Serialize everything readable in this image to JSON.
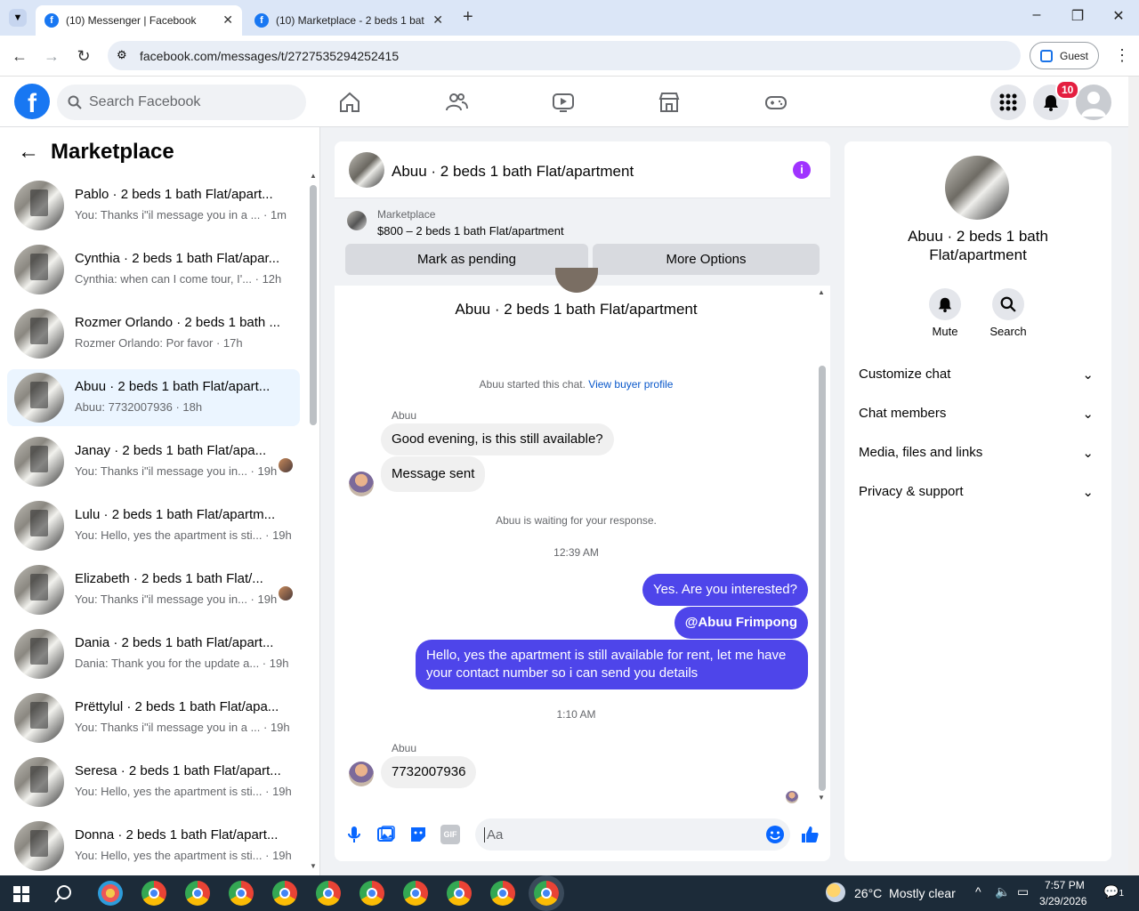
{
  "browser": {
    "tabs": [
      {
        "title": "(10) Messenger | Facebook",
        "active": true
      },
      {
        "title": "(10) Marketplace - 2 beds 1 bat",
        "active": false
      }
    ],
    "url": "facebook.com/messages/t/2727535294252415",
    "guest_label": "Guest"
  },
  "fb": {
    "search_placeholder": "Search Facebook",
    "notifications_count": "10"
  },
  "left": {
    "title": "Marketplace",
    "conversations": [
      {
        "title": "Pablo · 2 beds 1 bath Flat/apart...",
        "snippet": "You: Thanks i\"il message you in a ... · 1m"
      },
      {
        "title": "Cynthia · 2 beds 1 bath Flat/apar...",
        "snippet": "Cynthia: when can I come tour, I'... · 12h"
      },
      {
        "title": "Rozmer Orlando · 2 beds 1 bath ...",
        "snippet": "Rozmer Orlando: Por favor · 17h"
      },
      {
        "title": "Abuu · 2 beds 1 bath Flat/apart...",
        "snippet": "Abuu: 7732007936 · 18h",
        "selected": true
      },
      {
        "title": "Janay · 2 beds 1 bath Flat/apa...",
        "snippet": "You: Thanks i\"il message you in... · 19h",
        "read_receipt": true
      },
      {
        "title": "Lulu · 2 beds 1 bath Flat/apartm...",
        "snippet": "You: Hello, yes the apartment is sti... · 19h"
      },
      {
        "title": "Elizabeth · 2 beds 1 bath Flat/...",
        "snippet": "You: Thanks i\"il message you in... · 19h",
        "read_receipt": true
      },
      {
        "title": "Dania · 2 beds 1 bath Flat/apart...",
        "snippet": "Dania: Thank you for the update a... · 19h"
      },
      {
        "title": "Prëttylul · 2 beds 1 bath Flat/apa...",
        "snippet": "You: Thanks i\"il message you in a ... · 19h"
      },
      {
        "title": "Seresa · 2 beds 1 bath Flat/apart...",
        "snippet": "You: Hello, yes the apartment is sti... · 19h"
      },
      {
        "title": "Donna · 2 beds 1 bath Flat/apart...",
        "snippet": "You: Hello, yes the apartment is sti... · 19h"
      }
    ]
  },
  "chat": {
    "title": "Abuu · 2 beds 1 bath Flat/apartment",
    "marketplace_label": "Marketplace",
    "listing": "$800 – 2 beds 1 bath Flat/apartment",
    "mark_pending": "Mark as pending",
    "more_options": "More Options",
    "listing_title": "Abuu · 2 beds 1 bath Flat/apartment",
    "started_text": "Abuu started this chat.",
    "view_profile": "View buyer profile",
    "sender_name": "Abuu",
    "msg1": "Good evening, is this still available?",
    "msg2": "Message sent",
    "waiting": "Abuu is waiting for your response.",
    "time1": "12:39 AM",
    "out1": "Yes. Are you interested?",
    "out2": "@Abuu Frimpong",
    "out3": "Hello, yes the apartment is still available for rent, let me have your contact number so i can send you details",
    "time2": "1:10 AM",
    "msg3": "7732007936",
    "composer_placeholder": "Aa"
  },
  "right": {
    "title": "Abuu · 2 beds 1 bath Flat/apartment",
    "mute": "Mute",
    "search": "Search",
    "sections": [
      "Customize chat",
      "Chat members",
      "Media, files and links",
      "Privacy & support"
    ]
  },
  "taskbar": {
    "weather": "26°C  Mostly clear",
    "time": "7:57 PM",
    "date": "3/29/2026",
    "notif": "1"
  }
}
